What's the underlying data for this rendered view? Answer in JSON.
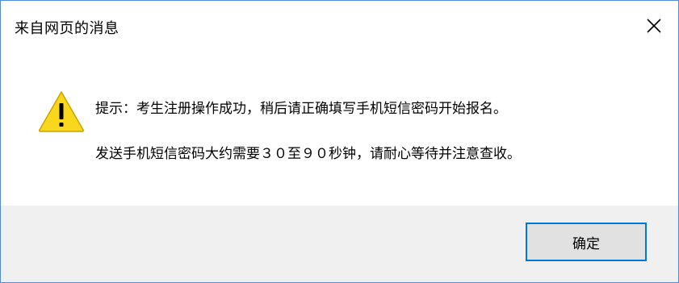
{
  "dialog": {
    "title": "来自网页的消息",
    "close_icon": "close-icon",
    "icon": "warning-icon",
    "message_line1": "提示：考生注册操作成功，稍后请正确填写手机短信密码开始报名。",
    "message_line2": "发送手机短信密码大约需要３０至９０秒钟，请耐心等待并注意查收。",
    "ok_label": "确定"
  },
  "colors": {
    "border": "#4f8cd9",
    "footer_bg": "#f0f0f0",
    "button_border": "#0078d7",
    "warning_fill": "#f9d71c"
  }
}
